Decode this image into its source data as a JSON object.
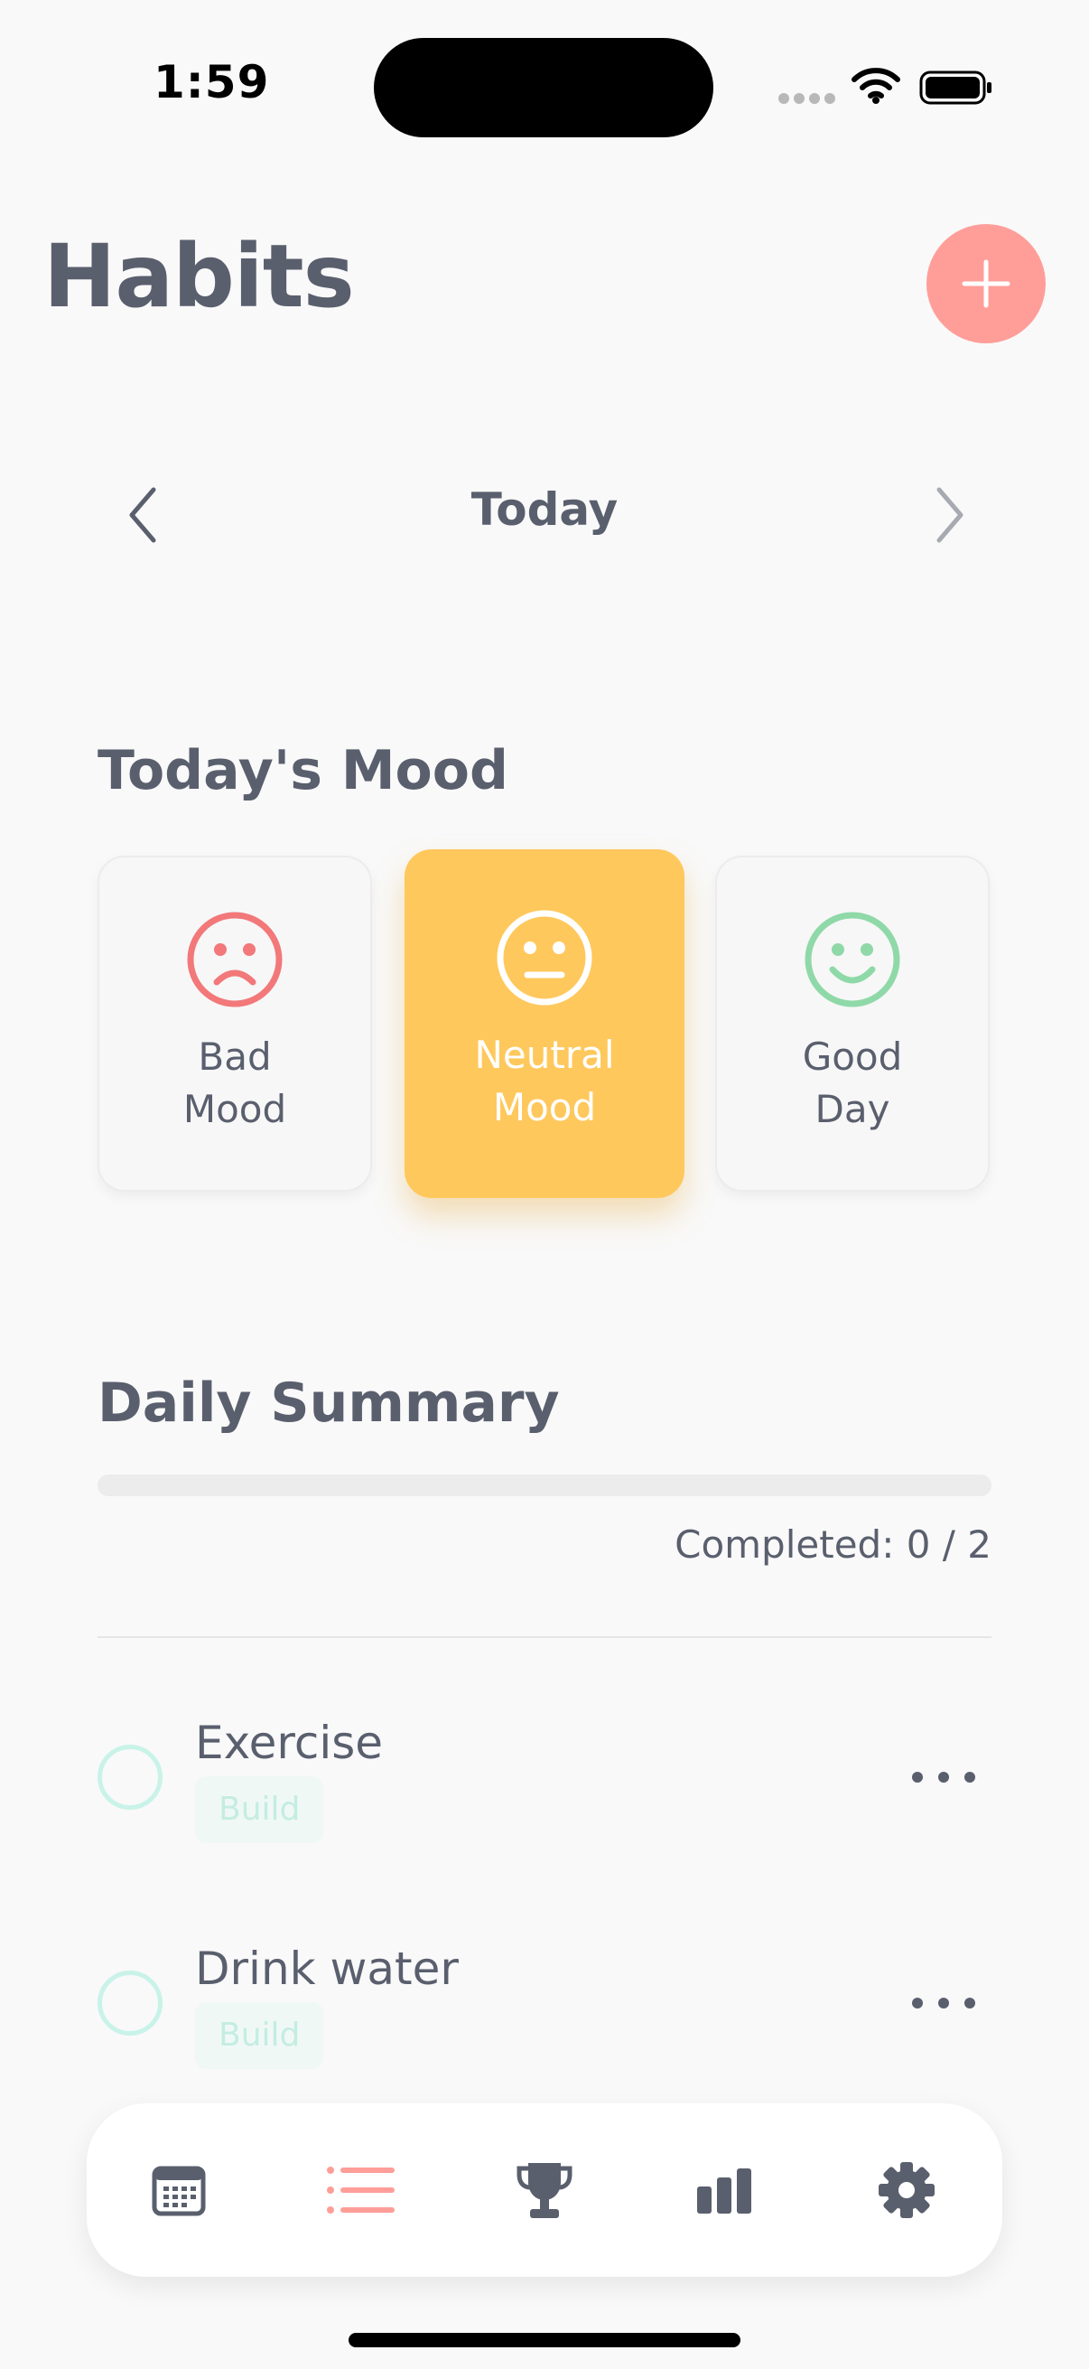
{
  "status_bar": {
    "time": "1:59"
  },
  "header": {
    "title": "Habits",
    "add_icon": "plus-icon"
  },
  "date_nav": {
    "label": "Today",
    "prev_icon": "chevron-left-icon",
    "next_icon": "chevron-right-icon"
  },
  "mood": {
    "title": "Today's Mood",
    "options": [
      {
        "label": "Bad\nMood",
        "icon": "sad-face-icon",
        "color": "#f2787a",
        "selected": false
      },
      {
        "label": "Neutral\nMood",
        "icon": "neutral-face-icon",
        "color": "#ffc85c",
        "selected": true
      },
      {
        "label": "Good\nDay",
        "icon": "happy-face-icon",
        "color": "#8fd9a8",
        "selected": false
      }
    ]
  },
  "summary": {
    "title": "Daily Summary",
    "completed_text": "Completed: 0 / 2",
    "completed": 0,
    "total": 2
  },
  "habits": [
    {
      "name": "Exercise",
      "tag": "Build"
    },
    {
      "name": "Drink water",
      "tag": "Build"
    }
  ],
  "tabbar": {
    "tabs": [
      {
        "icon": "calendar-icon",
        "active": false
      },
      {
        "icon": "list-icon",
        "active": true
      },
      {
        "icon": "trophy-icon",
        "active": false
      },
      {
        "icon": "bar-chart-icon",
        "active": false
      },
      {
        "icon": "gear-icon",
        "active": false
      }
    ]
  },
  "colors": {
    "accent": "#ff9e99",
    "neutral_mood": "#ffc85c",
    "text": "#5a5f6e",
    "habit_accent": "#c9f3e8"
  }
}
